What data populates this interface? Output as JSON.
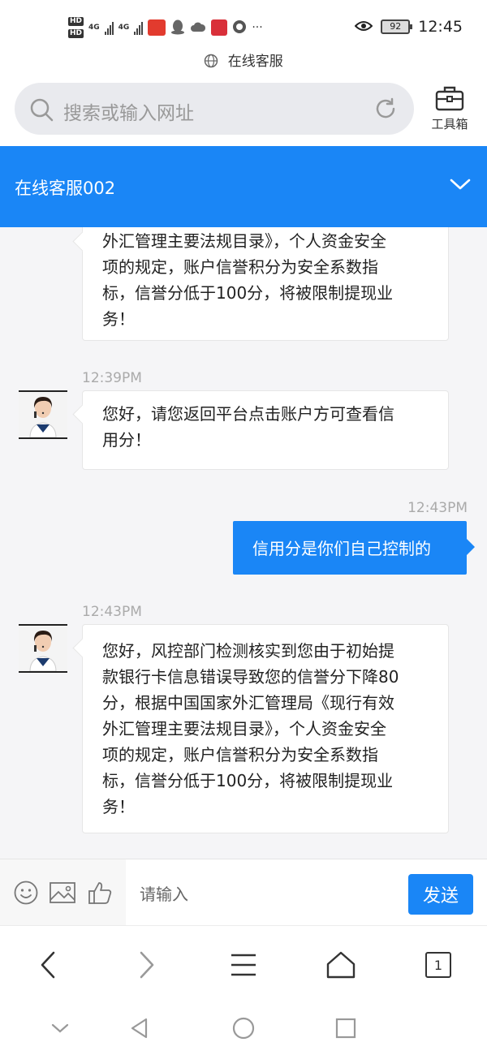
{
  "status_bar": {
    "badge_hd": "HD",
    "net_label": "4G",
    "battery": "92",
    "time": "12:45",
    "more": "···"
  },
  "url_bar": {
    "title": "在线客服"
  },
  "browser": {
    "search_placeholder": "搜索或输入网址",
    "toolbox_label": "工具箱"
  },
  "chat": {
    "header_title": "在线客服002",
    "messages": [
      {
        "sender": "agent",
        "time": "",
        "lines": [
          "外汇管理主要法规目录》，个人资金安全",
          "项的规定，账户信誉积分为安全系数指",
          "标，信誉分低于100分，将被限制提现业",
          "务！"
        ]
      },
      {
        "sender": "agent",
        "time": "12:39PM",
        "lines": [
          "您好，请您返回平台点击账户方可查看信",
          "用分！"
        ]
      },
      {
        "sender": "user",
        "time": "12:43PM",
        "lines": [
          "信用分是你们自己控制的"
        ]
      },
      {
        "sender": "agent",
        "time": "12:43PM",
        "lines": [
          "您好，风控部门检测核实到您由于初始提",
          "款银行卡信息错误导致您的信誉分下降80",
          "分，根据中国国家外汇管理局《现行有效",
          "外汇管理主要法规目录》，个人资金安全",
          "项的规定，账户信誉积分为安全系数指",
          "标，信誉分低于100分，将被限制提现业",
          "务！"
        ]
      }
    ]
  },
  "input": {
    "placeholder": "请输入",
    "send_label": "发送",
    "icons": [
      "emoji-icon",
      "image-icon",
      "thumbs-up-icon"
    ]
  },
  "browser_nav": {
    "tab_count": "1"
  },
  "colors": {
    "accent": "#1a86f6",
    "background": "#f5f5f7"
  }
}
